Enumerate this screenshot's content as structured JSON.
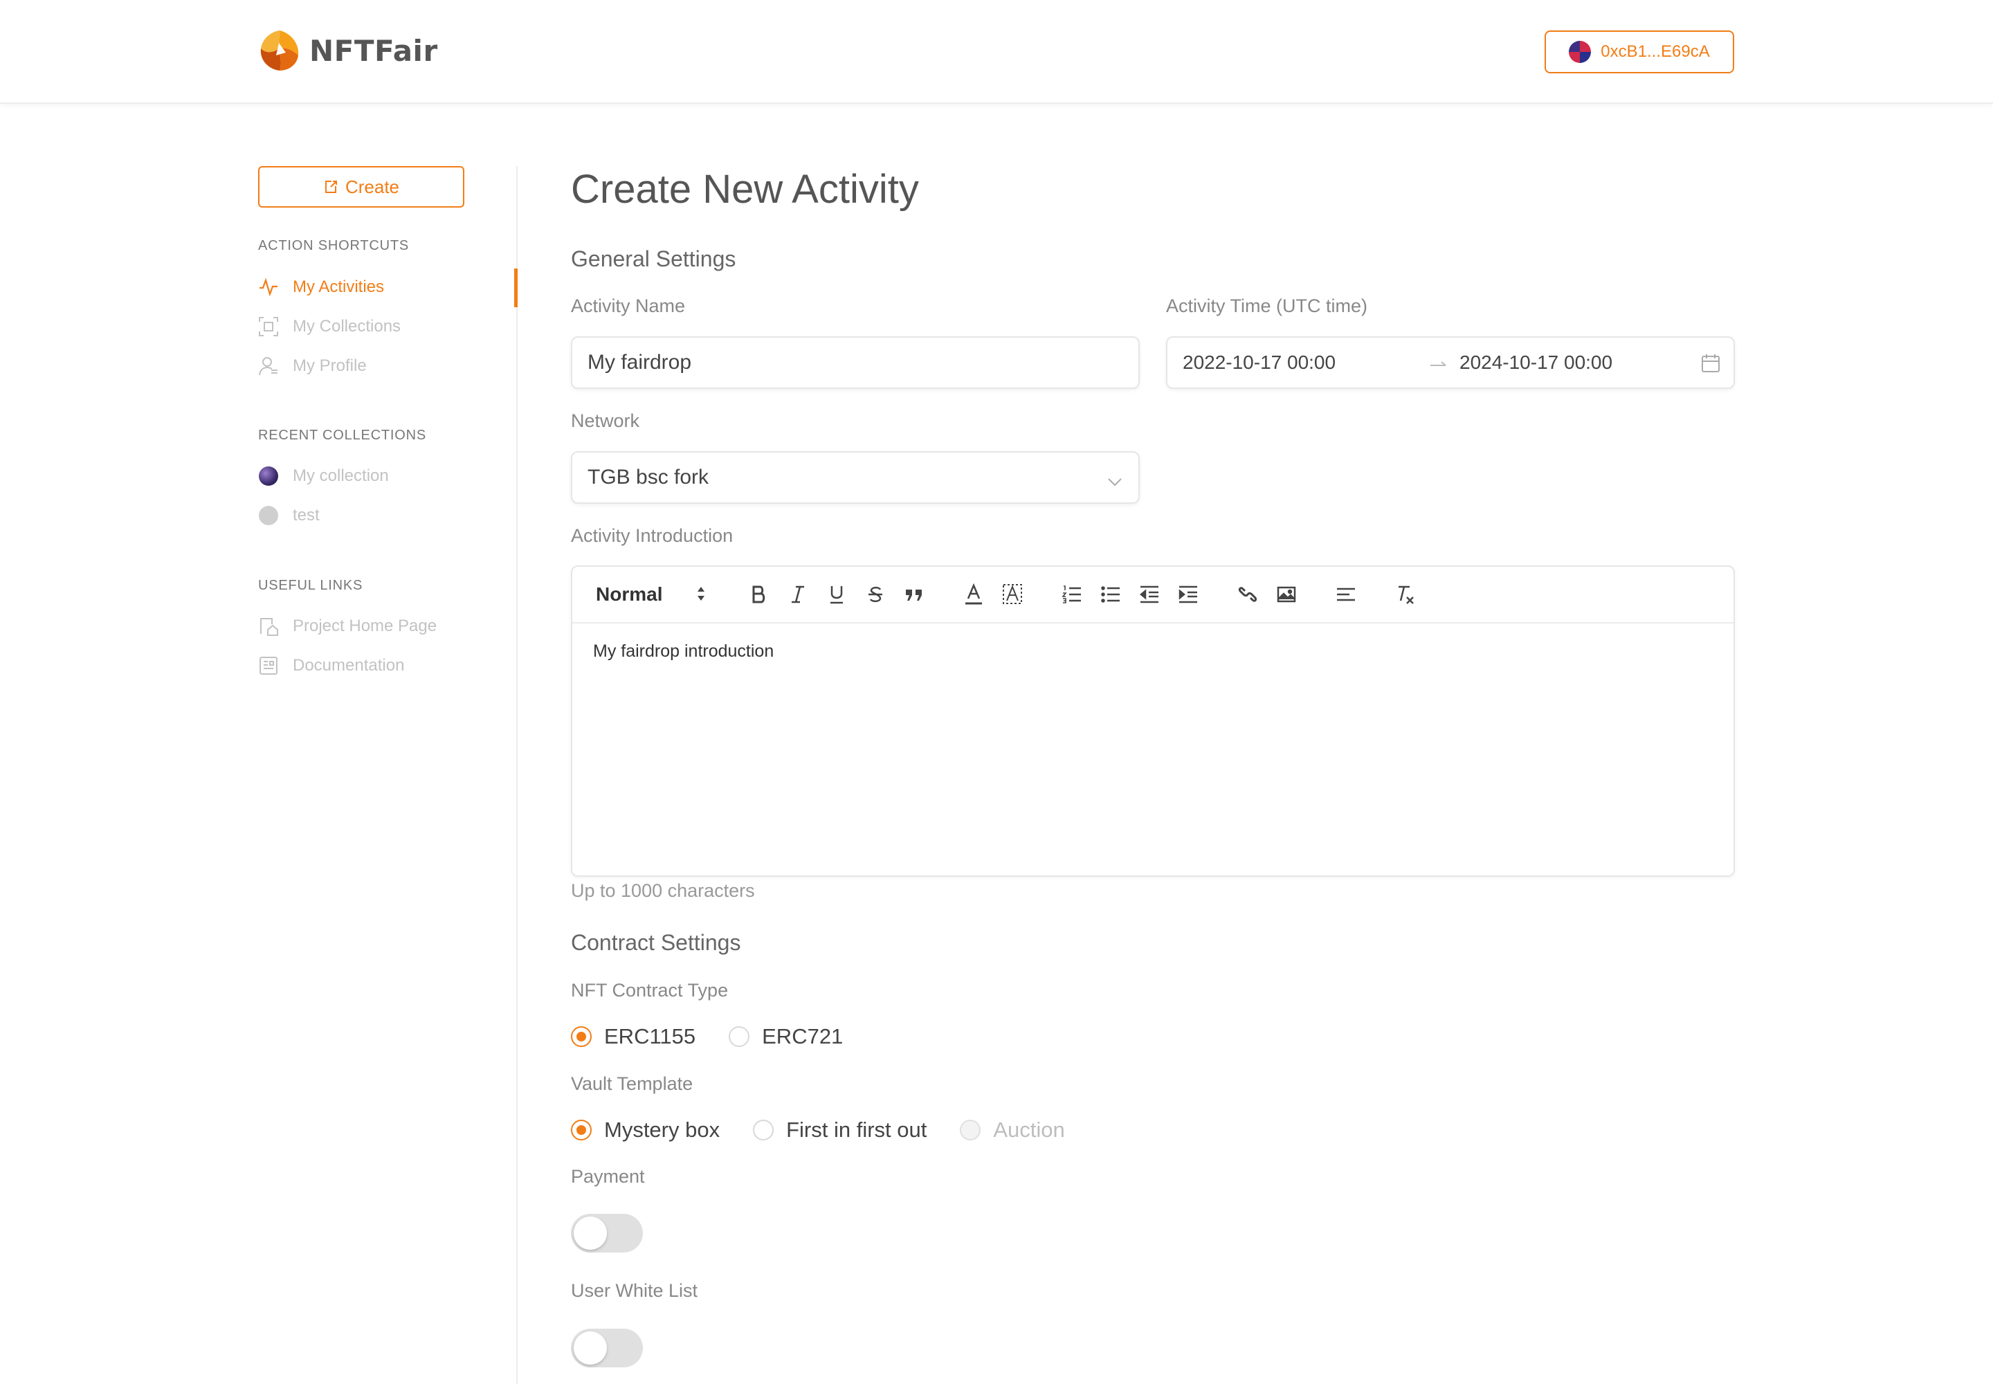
{
  "brand": {
    "name": "NFTFair"
  },
  "wallet": {
    "address": "0xcB1...E69cA"
  },
  "sidebar": {
    "create_label": "Create",
    "shortcuts_title": "ACTION SHORTCUTS",
    "shortcuts": [
      {
        "label": "My Activities",
        "active": true
      },
      {
        "label": "My Collections",
        "active": false
      },
      {
        "label": "My Profile",
        "active": false
      }
    ],
    "recent_title": "RECENT COLLECTIONS",
    "recent": [
      {
        "label": "My collection"
      },
      {
        "label": "test"
      }
    ],
    "links_title": "USEFUL LINKS",
    "links": [
      {
        "label": "Project Home Page"
      },
      {
        "label": "Documentation"
      }
    ]
  },
  "main": {
    "title": "Create New Activity",
    "general": {
      "title": "General Settings",
      "name_label": "Activity Name",
      "name_value": "My fairdrop",
      "time_label": "Activity Time (UTC time)",
      "time_start": "2022-10-17 00:00",
      "time_end": "2024-10-17 00:00",
      "network_label": "Network",
      "network_value": "TGB bsc fork",
      "intro_label": "Activity Introduction",
      "intro_format": "Normal",
      "intro_value": "My fairdrop introduction",
      "intro_hint": "Up to 1000 characters"
    },
    "contract": {
      "title": "Contract Settings",
      "type_label": "NFT Contract Type",
      "types": [
        {
          "label": "ERC1155",
          "checked": true
        },
        {
          "label": "ERC721",
          "checked": false
        }
      ],
      "vault_label": "Vault Template",
      "vaults": [
        {
          "label": "Mystery box",
          "checked": true
        },
        {
          "label": "First in first out",
          "checked": false
        },
        {
          "label": "Auction",
          "checked": false,
          "disabled": true
        }
      ],
      "payment_label": "Payment",
      "payment_on": false,
      "whitelist_label": "User White List",
      "whitelist_on": false
    }
  },
  "colors": {
    "accent": "#f27d16"
  }
}
